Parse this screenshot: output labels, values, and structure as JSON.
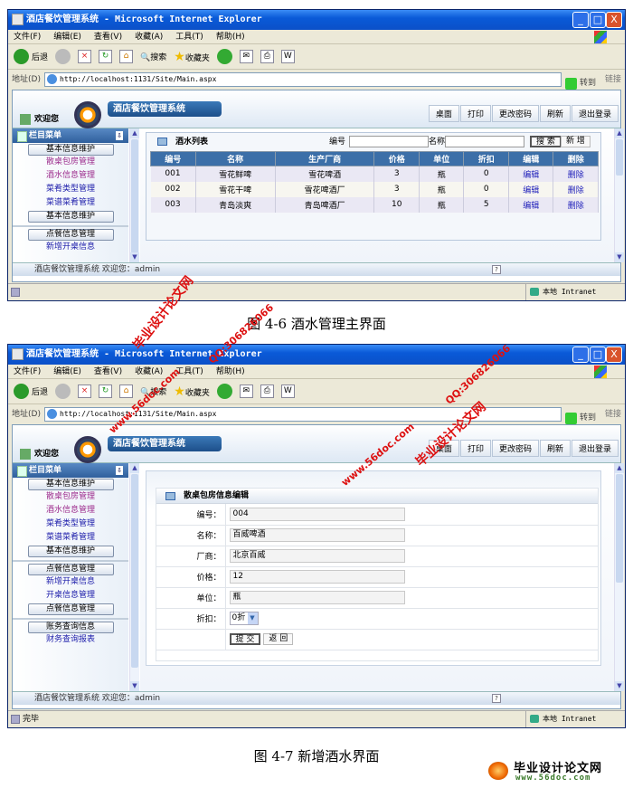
{
  "windows": [
    {
      "title": "酒店餐饮管理系统 - Microsoft Internet Explorer",
      "menu": [
        "文件(F)",
        "编辑(E)",
        "查看(V)",
        "收藏(A)",
        "工具(T)",
        "帮助(H)"
      ],
      "toolbar": {
        "back": "后退",
        "search": "搜索",
        "favorites": "收藏夹"
      },
      "address_label": "地址(D)",
      "url": "http://localhost:1131/Site/Main.aspx",
      "go": "转到",
      "links": "链接",
      "welcome": "欢迎您",
      "app_title": "酒店餐饮管理系统",
      "nav": [
        "桌面",
        "打印",
        "更改密码",
        "刷新",
        "退出登录"
      ],
      "side_header": "栏目菜单",
      "side": {
        "b1": "基本信息维护",
        "l1": "散桌包房管理",
        "l2": "酒水信息管理",
        "l3": "菜肴类型管理",
        "l4": "菜谱菜肴管理",
        "b2": "基本信息维护",
        "b3": "点餐信息管理",
        "l5": "新增开桌信息"
      },
      "app_status": "酒店餐饮管理系统 欢迎您：admin",
      "ie_status": "",
      "zone": "本地 Intranet"
    },
    {
      "title": "酒店餐饮管理系统 - Microsoft Internet Explorer",
      "menu": [
        "文件(F)",
        "编辑(E)",
        "查看(V)",
        "收藏(A)",
        "工具(T)",
        "帮助(H)"
      ],
      "toolbar": {
        "back": "后退",
        "search": "搜索",
        "favorites": "收藏夹"
      },
      "address_label": "地址(D)",
      "url": "http://localhost:1131/Site/Main.aspx",
      "go": "转到",
      "links": "链接",
      "welcome": "欢迎您",
      "app_title": "酒店餐饮管理系统",
      "nav": [
        "桌面",
        "打印",
        "更改密码",
        "刷新",
        "退出登录"
      ],
      "side_header": "栏目菜单",
      "side": {
        "b1": "基本信息维护",
        "l1": "散桌包房管理",
        "l2": "酒水信息管理",
        "l3": "菜肴类型管理",
        "l4": "菜谱菜肴管理",
        "b2": "基本信息维护",
        "b3": "点餐信息管理",
        "l5": "新增开桌信息",
        "l6": "开桌信息管理",
        "b4": "点餐信息管理",
        "b5": "账务查询信息",
        "l7": "财务查询报表"
      },
      "app_status": "酒店餐饮管理系统 欢迎您：admin",
      "ie_status": "完毕",
      "zone": "本地 Intranet"
    }
  ],
  "list": {
    "title": "酒水列表",
    "search_id_label": "编号",
    "search_name_label": "名称",
    "search_button": "搜 索",
    "add_button": "新 增",
    "columns": [
      "编号",
      "名称",
      "生产厂商",
      "价格",
      "单位",
      "折扣",
      "编辑",
      "删除"
    ],
    "rows": [
      [
        "001",
        "雪花鲜啤",
        "雪花啤酒",
        "3",
        "瓶",
        "0",
        "编辑",
        "删除"
      ],
      [
        "002",
        "雪花干啤",
        "雪花啤酒厂",
        "3",
        "瓶",
        "0",
        "编辑",
        "删除"
      ],
      [
        "003",
        "青岛淡爽",
        "青岛啤酒厂",
        "10",
        "瓶",
        "5",
        "编辑",
        "删除"
      ]
    ]
  },
  "form": {
    "title": "散桌包房信息编辑",
    "fields": [
      {
        "label": "编号：",
        "value": "004"
      },
      {
        "label": "名称：",
        "value": "百威啤酒"
      },
      {
        "label": "厂商：",
        "value": "北京百威"
      },
      {
        "label": "价格：",
        "value": "12"
      },
      {
        "label": "单位：",
        "value": "瓶"
      }
    ],
    "discount_label": "折扣：",
    "discount_value": "0折",
    "submit": "提 交",
    "back": "返 回"
  },
  "captions": {
    "fig1": "图 4-6 酒水管理主界面",
    "fig2": "图 4-7 新增酒水界面"
  },
  "watermark": {
    "site_name": "毕业设计论文网",
    "url": "www.56doc.com",
    "qq": "QQ:306826066"
  },
  "footer_logo": {
    "name": "毕业设计论文网",
    "url": "www.56doc.com"
  },
  "colors": {
    "header_blue": "#3c6fa8",
    "link_blue": "#2222bb",
    "visited_purple": "#9c2b8c",
    "watermark_red": "#dd1111"
  }
}
